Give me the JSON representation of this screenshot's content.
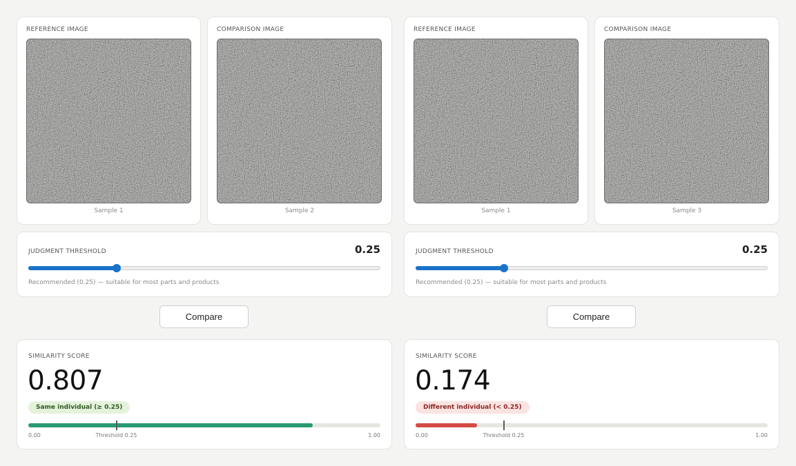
{
  "colors": {
    "background": "#f4f4f2",
    "slider_accent": "#1a73c9",
    "bar_pass": "#2a9a72",
    "bar_fail": "#d44a44",
    "badge_pass_bg": "#e4f2dc",
    "badge_fail_bg": "#fbe3e1"
  },
  "panels": [
    {
      "reference": {
        "label": "REFERENCE IMAGE",
        "caption": "Sample 1"
      },
      "comparison": {
        "label": "COMPARISON IMAGE",
        "caption": "Sample 2"
      },
      "threshold": {
        "label": "JUDGMENT THRESHOLD",
        "value": 0.25,
        "display": "0.25",
        "hint": "Recommended (0.25) — suitable for most parts and products"
      },
      "compare_button": "Compare",
      "result": {
        "label": "SIMILARITY SCORE",
        "score": 0.807,
        "display": "0.807",
        "verdict": "same",
        "badge": "Same individual (≥ 0.25)",
        "bar_min": "0.00",
        "bar_max": "1.00",
        "bar_threshold_label": "Threshold 0.25"
      }
    },
    {
      "reference": {
        "label": "REFERENCE IMAGE",
        "caption": "Sample 1"
      },
      "comparison": {
        "label": "COMPARISON IMAGE",
        "caption": "Sample 3"
      },
      "threshold": {
        "label": "JUDGMENT THRESHOLD",
        "value": 0.25,
        "display": "0.25",
        "hint": "Recommended (0.25) — suitable for most parts and products"
      },
      "compare_button": "Compare",
      "result": {
        "label": "SIMILARITY SCORE",
        "score": 0.174,
        "display": "0.174",
        "verdict": "different",
        "badge": "Different individual (< 0.25)",
        "bar_min": "0.00",
        "bar_max": "1.00",
        "bar_threshold_label": "Threshold 0.25"
      }
    }
  ]
}
